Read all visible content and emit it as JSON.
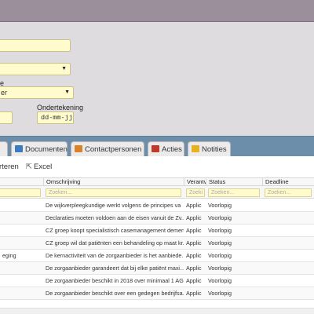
{
  "form": {
    "date_label": "Ondertekening",
    "select2_partial": "er",
    "label3_partial": "e",
    "date_placeholder": "dd-mm-jjjj"
  },
  "tabs": [
    {
      "label": "Documenten",
      "icon": "documents-icon",
      "color": "#3b7bbf"
    },
    {
      "label": "Contactpersonen",
      "icon": "contacts-icon",
      "color": "#d9822b"
    },
    {
      "label": "Acties",
      "icon": "actions-icon",
      "color": "#c0392b"
    },
    {
      "label": "Notities",
      "icon": "notes-icon",
      "color": "#e8b21f"
    }
  ],
  "toolbar": {
    "import_label": "rteren",
    "excel_label": "Excel"
  },
  "grid": {
    "columns": [
      "Omschrijving",
      "Verantv",
      "Status",
      "Deadline"
    ],
    "filter_placeholder": "Zoeken...",
    "verant_filter_placeholder": "Zoeki",
    "rows": [
      {
        "left": "",
        "omschrijving": "De wijkverpleegkundige werkt volgens de principes va",
        "verant": "Applic",
        "status": "Voorlopig"
      },
      {
        "left": "",
        "omschrijving": "Declaraties moeten voldoen aan de eisen vanuit de Zv...",
        "verant": "Applic",
        "status": "Voorlopig"
      },
      {
        "left": "",
        "omschrijving": "CZ groep koopt specialistisch casemanagement demen...",
        "verant": "Applic",
        "status": "Voorlopig"
      },
      {
        "left": "",
        "omschrijving": "CZ groep wil dat patiënten een behandeling op maat kr...",
        "verant": "Applic",
        "status": "Voorlopig"
      },
      {
        "left": "eging",
        "omschrijving": "De kernactiviteit van de zorgaanbieder is het aanbiede...",
        "verant": "Applic",
        "status": "Voorlopig"
      },
      {
        "left": "",
        "omschrijving": "De zorgaanbieder garandeert dat bij elke patiënt maxi...",
        "verant": "Applic",
        "status": "Voorlopig"
      },
      {
        "left": "",
        "omschrijving": "De zorgaanbieder beschikt in 2018 over minimaal 1 AG...",
        "verant": "Applic",
        "status": "Voorlopig"
      },
      {
        "left": "",
        "omschrijving": "De zorgaanbieder beschikt over een gedegen bedrijfsa...",
        "verant": "Applic",
        "status": "Voorlopig"
      }
    ]
  }
}
